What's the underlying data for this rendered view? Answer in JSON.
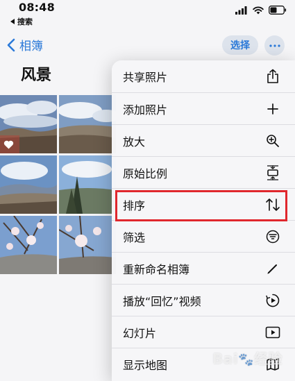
{
  "status_bar": {
    "time": "08:48",
    "back_app_label": "搜索"
  },
  "nav": {
    "back_label": "相簿",
    "select_label": "选择"
  },
  "album": {
    "title": "风景"
  },
  "menu": {
    "items": [
      {
        "label": "共享照片",
        "icon": "share-icon"
      },
      {
        "label": "添加照片",
        "icon": "plus-icon"
      },
      {
        "label": "放大",
        "icon": "zoom-in-icon"
      },
      {
        "label": "原始比例",
        "icon": "aspect-ratio-icon"
      },
      {
        "label": "排序",
        "icon": "sort-icon"
      },
      {
        "label": "筛选",
        "icon": "filter-icon"
      },
      {
        "label": "重新命名相簿",
        "icon": "pencil-icon"
      },
      {
        "label": "播放“回忆”视频",
        "icon": "memories-play-icon"
      },
      {
        "label": "幻灯片",
        "icon": "slideshow-icon"
      },
      {
        "label": "显示地图",
        "icon": "map-icon"
      }
    ]
  },
  "colors": {
    "accent": "#2b79d8",
    "highlight": "#e0272d"
  }
}
